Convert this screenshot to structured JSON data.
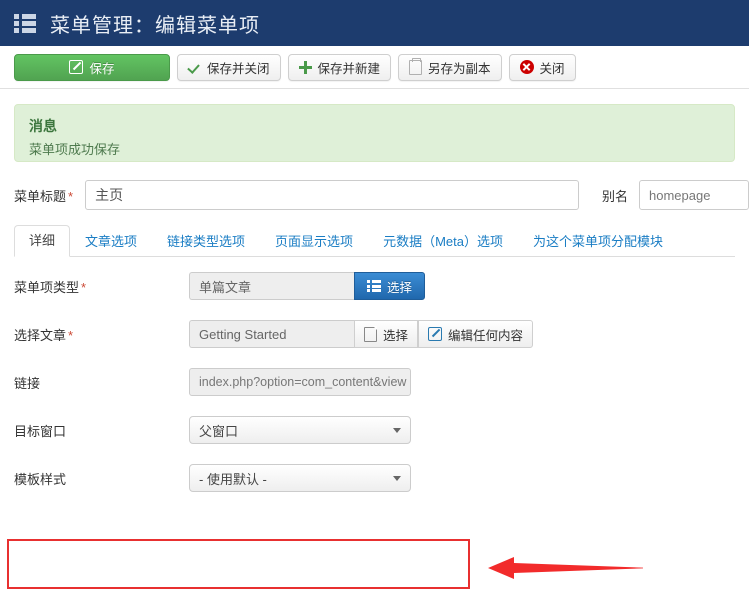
{
  "header": {
    "icon": "list-icon",
    "title": "菜单管理：编辑菜单项"
  },
  "toolbar": {
    "buttons": [
      {
        "label": "保存",
        "icon": "pencil-square-icon"
      },
      {
        "label": "保存并关闭",
        "icon": "check-icon"
      },
      {
        "label": "保存并新建",
        "icon": "plus-icon"
      },
      {
        "label": "另存为副本",
        "icon": "copy-icon"
      },
      {
        "label": "关闭",
        "icon": "close-circle-icon"
      }
    ]
  },
  "message": {
    "title": "消息",
    "text": "菜单项成功保存"
  },
  "title_row": {
    "menu_title_label": "菜单标题",
    "menu_title_required": "*",
    "menu_title_value": "主页",
    "menu_title_placeholder": "",
    "alias_label": "别名",
    "alias_value": "homepage",
    "alias_placeholder": ""
  },
  "tabs": [
    {
      "label": "详细",
      "active": true
    },
    {
      "label": "文章选项",
      "active": false
    },
    {
      "label": "链接类型选项",
      "active": false
    },
    {
      "label": "页面显示选项",
      "active": false
    },
    {
      "label": "元数据（Meta）选项",
      "active": false
    },
    {
      "label": "为这个菜单项分配模块",
      "active": false
    }
  ],
  "form": {
    "menu_item_type": {
      "label": "菜单项类型",
      "required": "*",
      "value": "单篇文章",
      "button_label": "选择",
      "button_icon": "list-icon"
    },
    "select_article": {
      "label": "选择文章",
      "required": "*",
      "value": "Getting Started",
      "select_button_label": "选择",
      "select_button_icon": "document-icon",
      "edit_button_label": "编辑任何内容",
      "edit_button_icon": "pencil-square-icon"
    },
    "link": {
      "label": "链接",
      "value": "index.php?option=com_content&view"
    },
    "target_window": {
      "label": "目标窗口",
      "value": "父窗口"
    },
    "template_style": {
      "label": "模板样式",
      "value": "- 使用默认 -"
    }
  },
  "annotations": {
    "highlight_color": "#e83030",
    "arrow_color": "#f22b2b",
    "arrow_direction": "left",
    "highlight_target": "菜单项类型"
  },
  "colors": {
    "header_bg": "#1d3c6e",
    "save_green": "#51a351",
    "select_blue": "#2068ad",
    "message_green_bg": "#dff0d8",
    "link_blue": "#1a7dc4"
  }
}
